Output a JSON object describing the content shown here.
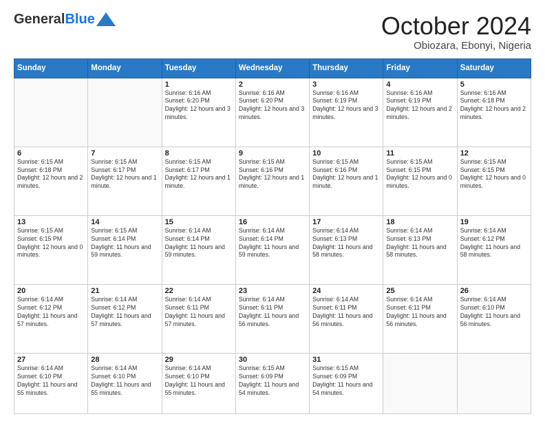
{
  "header": {
    "logo_general": "General",
    "logo_blue": "Blue",
    "month_title": "October 2024",
    "location": "Obiozara, Ebonyi, Nigeria"
  },
  "days_of_week": [
    "Sunday",
    "Monday",
    "Tuesday",
    "Wednesday",
    "Thursday",
    "Friday",
    "Saturday"
  ],
  "weeks": [
    [
      {
        "day": "",
        "info": ""
      },
      {
        "day": "",
        "info": ""
      },
      {
        "day": "1",
        "info": "Sunrise: 6:16 AM\nSunset: 6:20 PM\nDaylight: 12 hours and 3 minutes."
      },
      {
        "day": "2",
        "info": "Sunrise: 6:16 AM\nSunset: 6:20 PM\nDaylight: 12 hours and 3 minutes."
      },
      {
        "day": "3",
        "info": "Sunrise: 6:16 AM\nSunset: 6:19 PM\nDaylight: 12 hours and 3 minutes."
      },
      {
        "day": "4",
        "info": "Sunrise: 6:16 AM\nSunset: 6:19 PM\nDaylight: 12 hours and 2 minutes."
      },
      {
        "day": "5",
        "info": "Sunrise: 6:16 AM\nSunset: 6:18 PM\nDaylight: 12 hours and 2 minutes."
      }
    ],
    [
      {
        "day": "6",
        "info": "Sunrise: 6:15 AM\nSunset: 6:18 PM\nDaylight: 12 hours and 2 minutes."
      },
      {
        "day": "7",
        "info": "Sunrise: 6:15 AM\nSunset: 6:17 PM\nDaylight: 12 hours and 1 minute."
      },
      {
        "day": "8",
        "info": "Sunrise: 6:15 AM\nSunset: 6:17 PM\nDaylight: 12 hours and 1 minute."
      },
      {
        "day": "9",
        "info": "Sunrise: 6:15 AM\nSunset: 6:16 PM\nDaylight: 12 hours and 1 minute."
      },
      {
        "day": "10",
        "info": "Sunrise: 6:15 AM\nSunset: 6:16 PM\nDaylight: 12 hours and 1 minute."
      },
      {
        "day": "11",
        "info": "Sunrise: 6:15 AM\nSunset: 6:15 PM\nDaylight: 12 hours and 0 minutes."
      },
      {
        "day": "12",
        "info": "Sunrise: 6:15 AM\nSunset: 6:15 PM\nDaylight: 12 hours and 0 minutes."
      }
    ],
    [
      {
        "day": "13",
        "info": "Sunrise: 6:15 AM\nSunset: 6:15 PM\nDaylight: 12 hours and 0 minutes."
      },
      {
        "day": "14",
        "info": "Sunrise: 6:15 AM\nSunset: 6:14 PM\nDaylight: 11 hours and 59 minutes."
      },
      {
        "day": "15",
        "info": "Sunrise: 6:14 AM\nSunset: 6:14 PM\nDaylight: 11 hours and 59 minutes."
      },
      {
        "day": "16",
        "info": "Sunrise: 6:14 AM\nSunset: 6:14 PM\nDaylight: 11 hours and 59 minutes."
      },
      {
        "day": "17",
        "info": "Sunrise: 6:14 AM\nSunset: 6:13 PM\nDaylight: 11 hours and 58 minutes."
      },
      {
        "day": "18",
        "info": "Sunrise: 6:14 AM\nSunset: 6:13 PM\nDaylight: 11 hours and 58 minutes."
      },
      {
        "day": "19",
        "info": "Sunrise: 6:14 AM\nSunset: 6:12 PM\nDaylight: 11 hours and 58 minutes."
      }
    ],
    [
      {
        "day": "20",
        "info": "Sunrise: 6:14 AM\nSunset: 6:12 PM\nDaylight: 11 hours and 57 minutes."
      },
      {
        "day": "21",
        "info": "Sunrise: 6:14 AM\nSunset: 6:12 PM\nDaylight: 11 hours and 57 minutes."
      },
      {
        "day": "22",
        "info": "Sunrise: 6:14 AM\nSunset: 6:11 PM\nDaylight: 11 hours and 57 minutes."
      },
      {
        "day": "23",
        "info": "Sunrise: 6:14 AM\nSunset: 6:11 PM\nDaylight: 11 hours and 56 minutes."
      },
      {
        "day": "24",
        "info": "Sunrise: 6:14 AM\nSunset: 6:11 PM\nDaylight: 11 hours and 56 minutes."
      },
      {
        "day": "25",
        "info": "Sunrise: 6:14 AM\nSunset: 6:11 PM\nDaylight: 11 hours and 56 minutes."
      },
      {
        "day": "26",
        "info": "Sunrise: 6:14 AM\nSunset: 6:10 PM\nDaylight: 11 hours and 56 minutes."
      }
    ],
    [
      {
        "day": "27",
        "info": "Sunrise: 6:14 AM\nSunset: 6:10 PM\nDaylight: 11 hours and 55 minutes."
      },
      {
        "day": "28",
        "info": "Sunrise: 6:14 AM\nSunset: 6:10 PM\nDaylight: 11 hours and 55 minutes."
      },
      {
        "day": "29",
        "info": "Sunrise: 6:14 AM\nSunset: 6:10 PM\nDaylight: 11 hours and 55 minutes."
      },
      {
        "day": "30",
        "info": "Sunrise: 6:15 AM\nSunset: 6:09 PM\nDaylight: 11 hours and 54 minutes."
      },
      {
        "day": "31",
        "info": "Sunrise: 6:15 AM\nSunset: 6:09 PM\nDaylight: 11 hours and 54 minutes."
      },
      {
        "day": "",
        "info": ""
      },
      {
        "day": "",
        "info": ""
      }
    ]
  ]
}
